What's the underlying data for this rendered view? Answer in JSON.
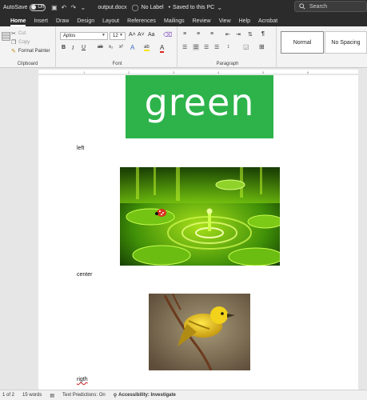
{
  "titlebar": {
    "autosave_label": "AutoSave",
    "autosave_state": "Off",
    "filename": "output.docx",
    "label_status": "No Label",
    "save_status": "Saved to this PC",
    "search_placeholder": "Search"
  },
  "tabs": [
    "Home",
    "Insert",
    "Draw",
    "Design",
    "Layout",
    "References",
    "Mailings",
    "Review",
    "View",
    "Help",
    "Acrobat"
  ],
  "active_tab": "Home",
  "ribbon": {
    "clipboard": {
      "label": "Clipboard",
      "cut": "Cut",
      "copy": "Copy",
      "format_painter": "Format Painter"
    },
    "font": {
      "label": "Font",
      "font_name": "Aptos",
      "font_size": "12",
      "bold": "B",
      "italic": "I",
      "underline": "U",
      "strikethrough": "ab",
      "subscript": "x₂",
      "superscript": "x²",
      "grow": "A˄",
      "shrink": "A˅",
      "change_case": "Aa",
      "font_color": "A",
      "highlight": "ab"
    },
    "paragraph": {
      "label": "Paragraph"
    },
    "styles": {
      "normal": "Normal",
      "no_spacing": "No Spacing"
    }
  },
  "ruler_ticks": [
    "1",
    "2",
    "3",
    "4",
    "5",
    "6"
  ],
  "document": {
    "paragraph_left": "left",
    "paragraph_center": "center",
    "paragraph_right": "rigth",
    "green_image_text": "green"
  },
  "statusbar": {
    "page": "1 of 2",
    "words": "15 words",
    "text_predictions": "Text Predictions: On",
    "accessibility": "Accessibility: Investigate"
  },
  "colors": {
    "titlebar": "#2b2b2b",
    "ribbon": "#f3f3f3",
    "green_image_bg": "#2db34a",
    "spell_error": "#c8201e"
  }
}
